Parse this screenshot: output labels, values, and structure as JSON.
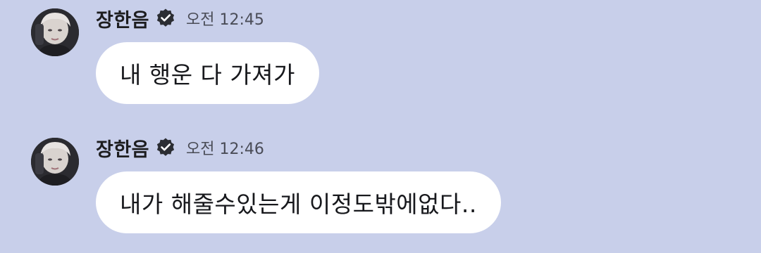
{
  "colors": {
    "background": "#c8cfea",
    "bubble": "#ffffff",
    "sender_text": "#1d1d1f",
    "time_text": "#4a4c57",
    "verified_badge": "#2b2d33"
  },
  "messages": [
    {
      "sender": "장한음",
      "verified_icon": "verified-badge-icon",
      "time": "오전 12:45",
      "text": "내 행운 다 가져가"
    },
    {
      "sender": "장한음",
      "verified_icon": "verified-badge-icon",
      "time": "오전 12:46",
      "text": "내가 해줄수있는게 이정도밖에없다.."
    }
  ]
}
